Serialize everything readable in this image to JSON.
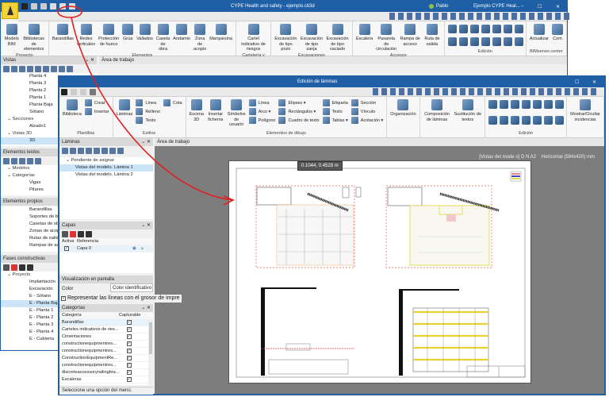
{
  "back_window": {
    "title": "CYPE Health and safety - ejemplo.cb3d",
    "user": "Pablo",
    "project": "Ejemplo CYPE Heal...",
    "window_controls": [
      "–",
      "☐",
      "✕"
    ],
    "ribbon": [
      {
        "label": "Proyecto",
        "items": [
          "Modelo BIM",
          "Bibliotecas de elementos"
        ]
      },
      {
        "label": "Elementos",
        "items": [
          "Barandillas",
          "Redes verticales",
          "Protección de hueco",
          "Grúa",
          "Vallados",
          "Caseta de obra",
          "Andamio",
          "Zona de acopio",
          "Marquesina"
        ]
      },
      {
        "label": "Cartelería y señalización",
        "items": [
          "Cartel indicativo de riesgos"
        ]
      },
      {
        "label": "Excavaciones",
        "items": [
          "Excavación de tipo pozo",
          "Excavación de tipo zanja",
          "Excavación de tipo vaciado"
        ]
      },
      {
        "label": "Accesos",
        "items": [
          "Escalera",
          "Pasarela de circulación",
          "Rampa de acceso",
          "Ruta de salida"
        ]
      },
      {
        "label": "Edición",
        "items": []
      },
      {
        "label": "BIMserver.center",
        "items": [
          "Actualizar",
          "Com"
        ]
      }
    ],
    "vistas": {
      "header": "Vistas",
      "items": [
        {
          "label": "Planta 4",
          "level": 2
        },
        {
          "label": "Planta 3",
          "level": 2
        },
        {
          "label": "Planta 2",
          "level": 2
        },
        {
          "label": "Planta 1",
          "level": 2
        },
        {
          "label": "Planta Baja",
          "level": 2
        },
        {
          "label": "Sótano",
          "level": 2
        },
        {
          "label": "Secciones",
          "level": 1
        },
        {
          "label": "Alzado1",
          "level": 2
        },
        {
          "label": "Vistas 3D",
          "level": 1
        },
        {
          "label": "3D",
          "level": 2,
          "selected": true
        }
      ]
    },
    "elementos_leidos": {
      "header": "Elementos leídos",
      "items": [
        {
          "label": "Modelos",
          "level": 1
        },
        {
          "label": "Categorías",
          "level": 1
        },
        {
          "label": "Vigas",
          "level": 2
        },
        {
          "label": "Pilares",
          "level": 2
        }
      ]
    },
    "elementos_propios": {
      "header": "Elementos propios",
      "items": [
        {
          "label": "Barandillas"
        },
        {
          "label": "Soportes de barandilla"
        },
        {
          "label": "Casetas de obra"
        },
        {
          "label": "Zonas de acopio"
        },
        {
          "label": "Rutas de salida"
        },
        {
          "label": "Rampas de acceso"
        }
      ]
    },
    "fases": {
      "header": "Fases constructivas",
      "items": [
        {
          "label": "Proyecto",
          "level": 1
        },
        {
          "label": "Implantación",
          "level": 2
        },
        {
          "label": "Excavación",
          "level": 2
        },
        {
          "label": "E - Sótano",
          "level": 2
        },
        {
          "label": "E - Planta Baja",
          "level": 2,
          "selected": true
        },
        {
          "label": "E - Planta 1",
          "level": 2
        },
        {
          "label": "E - Planta 2",
          "level": 2
        },
        {
          "label": "E - Planta 3",
          "level": 2
        },
        {
          "label": "E - Planta 4",
          "level": 2
        },
        {
          "label": "E - Cubierta",
          "level": 2
        }
      ]
    },
    "work_area": "Área de trabajo"
  },
  "front_window": {
    "title": "Edición de láminas",
    "window_controls": [
      "☐",
      "✕"
    ],
    "ribbon": [
      {
        "label": "Plantillas",
        "items": [
          "Biblioteca"
        ],
        "small": [
          "Crear",
          "Insertar"
        ]
      },
      {
        "label": "Estilos",
        "items": [
          "Láminas"
        ],
        "small": [
          "Línea",
          "Relleno",
          "Texto",
          "Cota"
        ]
      },
      {
        "label": "Elementos de dibujo",
        "items": [
          "Escena 3D",
          "Insertar ficheros",
          "Símbolos de usuario"
        ],
        "small": [
          "Línea",
          "Arco ▾",
          "Polígono",
          "Elipses ▾",
          "Rectángulos ▾",
          "Cuadro de texto",
          "Etiqueta",
          "Texto",
          "Tablas ▾",
          "Sección",
          "Vínculo",
          "Acotación ▾"
        ]
      },
      {
        "label": "",
        "items": [
          "Organización"
        ],
        "small": []
      },
      {
        "label": "",
        "items": [
          "Composición de láminas",
          "Sustitución de textos"
        ],
        "small": []
      },
      {
        "label": "Edición",
        "items": [],
        "small": []
      },
      {
        "label": "",
        "items": [
          "Mostrar/Ocultar incidencias"
        ],
        "small": []
      }
    ],
    "laminas": {
      "header": "Láminas",
      "items": [
        {
          "label": "Pendiente de asignar",
          "level": 1
        },
        {
          "label": "Vistas del modelo. Lámina 1",
          "level": 2,
          "selected": true
        },
        {
          "label": "Vistas del modelo. Lámina 2",
          "level": 2
        }
      ]
    },
    "capas": {
      "header": "Capas",
      "columns": [
        "Activa",
        "Referencia"
      ],
      "rows": [
        {
          "active": true,
          "reference": "Capa 0"
        }
      ]
    },
    "visualizacion": {
      "header": "Visualización en pantalla",
      "color_label": "Color",
      "color_value": "Color identificativo",
      "checkbox_label": "Representar las líneas con el grosor de impre",
      "checkbox_checked": true
    },
    "categorias": {
      "header": "Categorías",
      "columns": [
        "Categoría",
        "Capturable"
      ],
      "rows": [
        "Barandillas",
        "Carteles indicativos de ries...",
        "Cimentaciones",
        "constructionequipmentres...",
        "constructionequipmentres...",
        "ConstructionEquipmentRe...",
        "constructionequipmentres...",
        "discreteaccessoryrailingbra...",
        "Escaleras"
      ]
    },
    "work_area": "Área de trabajo",
    "sheet_label": "[Vistas del mode o] D N A2    Horizontal (594x420) mm",
    "cursor_coords": "0.1044, 0.4528 m",
    "status": "Seleccione una opción del menú."
  },
  "colors": {
    "titlebar": "#1f5fa6",
    "annotation": "#e02020",
    "selection": "#cce4f7",
    "canvas": "#7d7d7d"
  }
}
